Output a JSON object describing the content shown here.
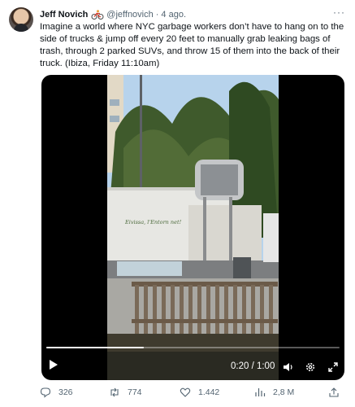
{
  "author": {
    "name": "Jeff Novich",
    "handle": "@jeffnovich",
    "separator": "·",
    "time": "4 ago.",
    "emoji_icon": "cyclist-icon"
  },
  "menu": {
    "more_label": "···"
  },
  "tweet": {
    "text": "Imagine a world where NYC garbage workers don’t have to hang on to the side of trucks & jump off every 20 feet to manually grab leaking bags of trash, through 2 parked SUVs, and throw 15 of them into the back of their truck. (Ibiza, Friday 11:10am)"
  },
  "video": {
    "truck_text": "Eivissa, l'Entorn net!",
    "timecode": "0:20 / 1:00",
    "progress": 0.333,
    "controls": [
      "play-icon",
      "volume-icon",
      "settings-icon",
      "fullscreen-icon"
    ]
  },
  "actions": {
    "replies": "326",
    "reposts": "774",
    "likes": "1.442",
    "views": "2,8 M"
  },
  "colors": {
    "text": "#0f1419",
    "secondary": "#536471",
    "video_bg": "#000000"
  }
}
